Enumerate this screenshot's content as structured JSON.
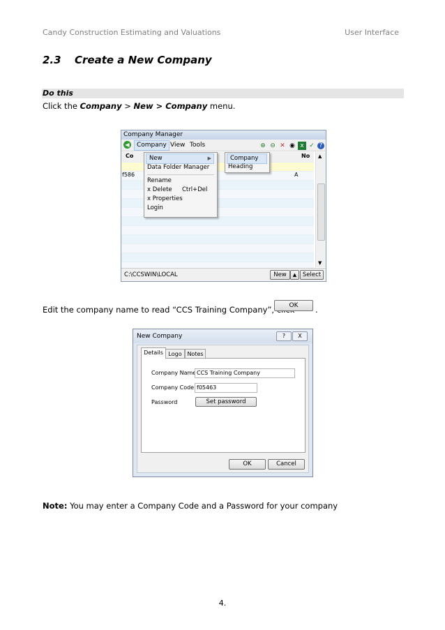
{
  "header": {
    "left": "Candy Construction Estimating and Valuations",
    "right": "User Interface"
  },
  "section": {
    "number": "2.3",
    "title": "Create a New Company"
  },
  "do_this": "Do this",
  "instruction1": {
    "p1": "Click the ",
    "b1": "Company",
    "p2": " > ",
    "b2": "New > Company",
    "p3": " menu."
  },
  "company_manager": {
    "title": "Company Manager",
    "menus": [
      "Company",
      "View",
      "Tools"
    ],
    "col_code": "Co",
    "col_no": "No",
    "row_code": "f586",
    "row_no": "A",
    "company_menu": [
      "New",
      "Data Folder Manager",
      "Rename",
      "x Delete",
      "x Properties",
      "Login"
    ],
    "delete_shortcut": "Ctrl+Del",
    "submenu": [
      "Company",
      "Heading"
    ],
    "status_path": "C:\\CCSWIN\\LOCAL",
    "new_button": "New",
    "select_button": "Select"
  },
  "instruction2": {
    "text": "Edit the company name to read “CCS Training Company”, click ",
    "ok_label": "OK",
    "end": "."
  },
  "new_company": {
    "title": "New Company",
    "help": "?",
    "close": "X",
    "tabs": [
      "Details",
      "Logo",
      "Notes"
    ],
    "name_label": "Company Name",
    "name_value": "CCS Training Company",
    "code_label": "Company Code",
    "code_value": "f05463",
    "password_label": "Password",
    "set_password": "Set password",
    "ok": "OK",
    "cancel": "Cancel"
  },
  "note": {
    "bold": "Note:",
    "text": " You may enter a Company Code and a Password for your company"
  },
  "page_number": "4."
}
